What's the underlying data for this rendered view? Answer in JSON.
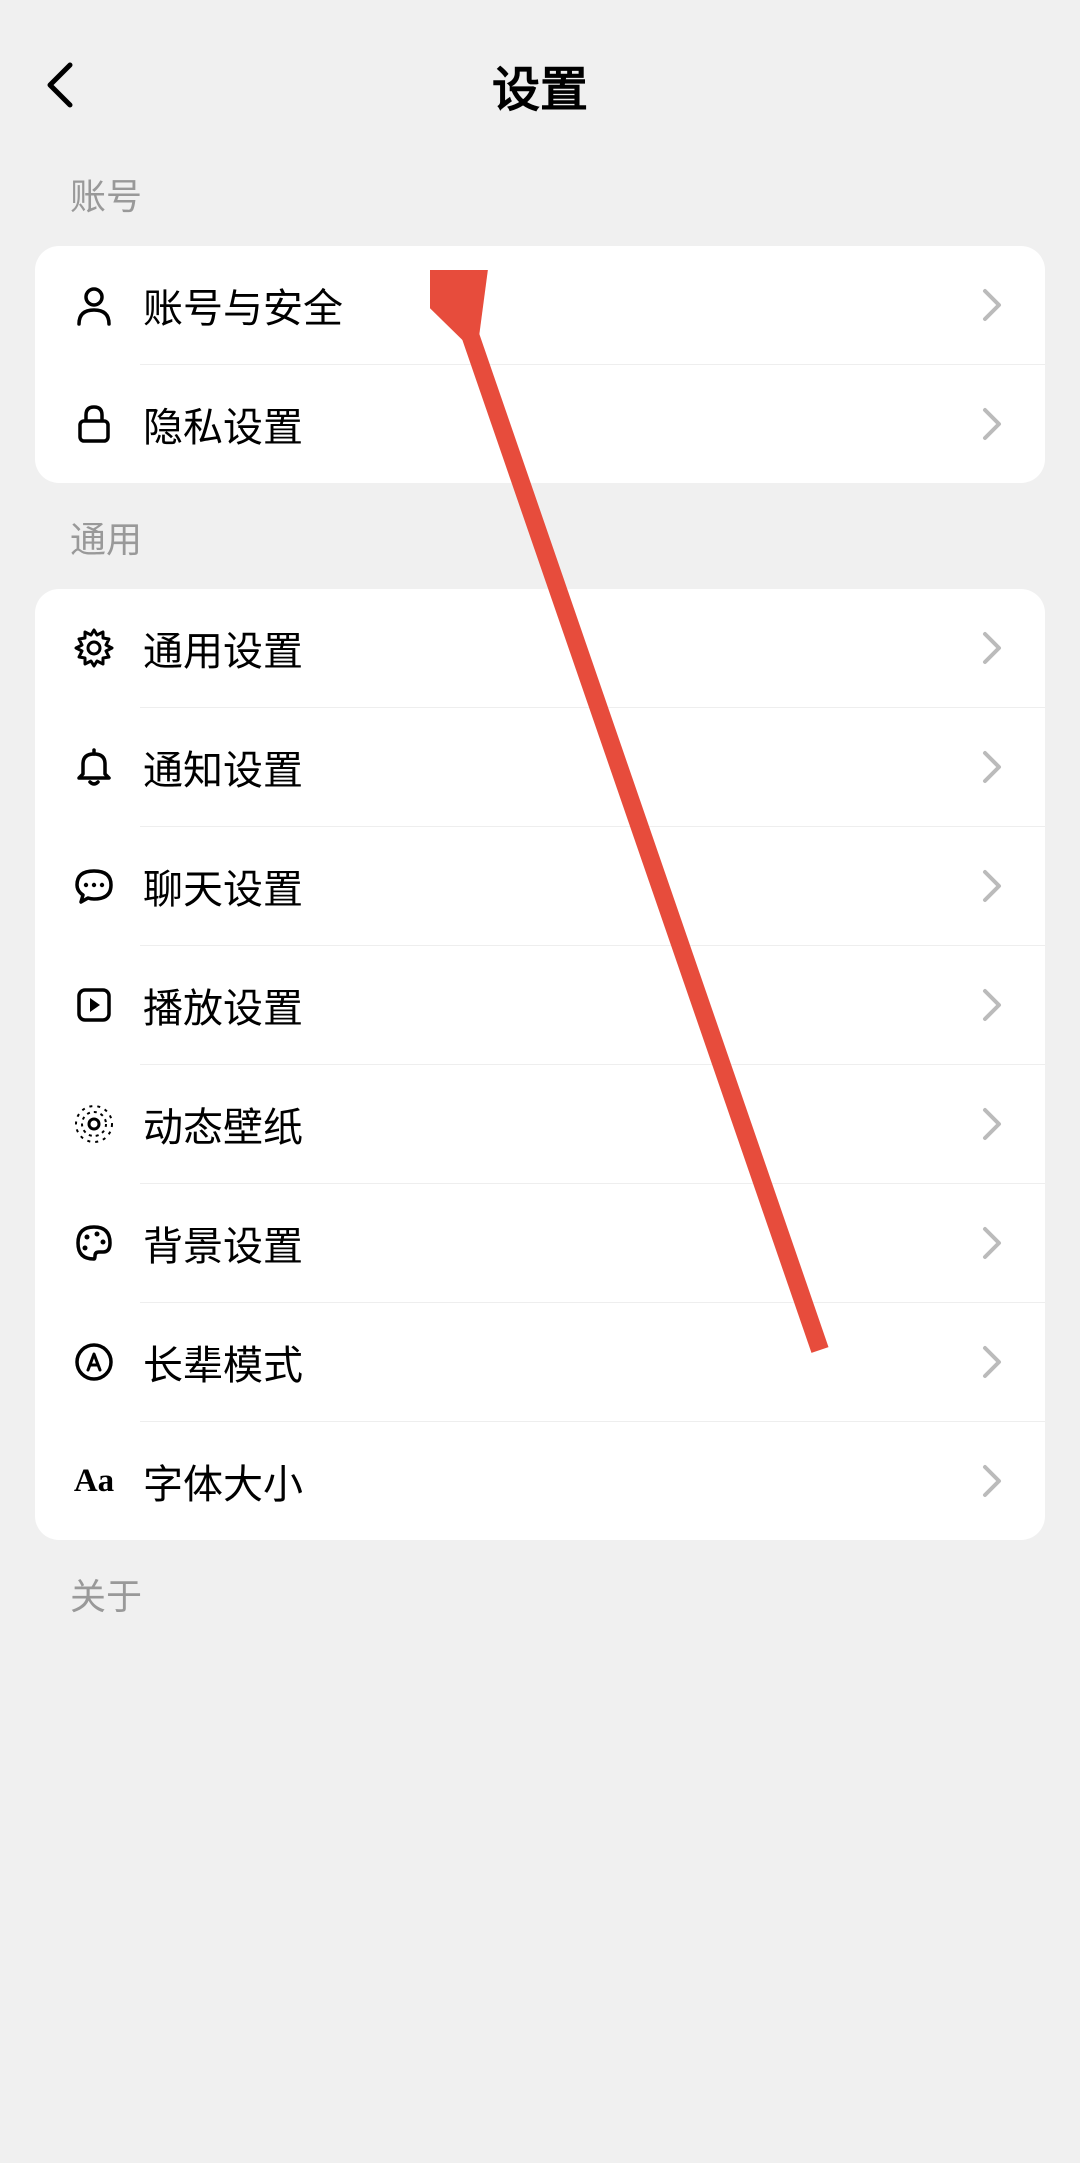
{
  "header": {
    "title": "设置"
  },
  "sections": {
    "account": {
      "label": "账号",
      "items": {
        "account_security": "账号与安全",
        "privacy": "隐私设置"
      }
    },
    "general": {
      "label": "通用",
      "items": {
        "general_settings": "通用设置",
        "notification": "通知设置",
        "chat": "聊天设置",
        "playback": "播放设置",
        "live_wallpaper": "动态壁纸",
        "background": "背景设置",
        "elder_mode": "长辈模式",
        "font_size": "字体大小"
      }
    },
    "about": {
      "label": "关于"
    }
  },
  "font_icon_text": "Aa"
}
